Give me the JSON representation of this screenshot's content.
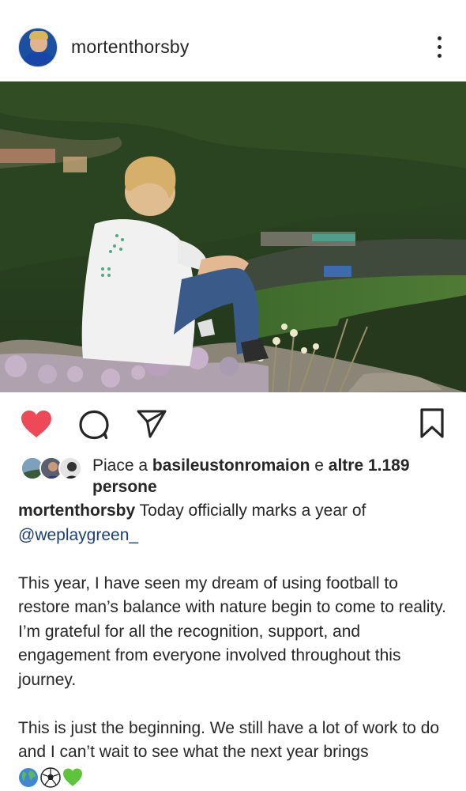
{
  "post": {
    "username": "mortenthorsby",
    "likes": {
      "prefix": "Piace a",
      "first_liker": "basileustonromaion",
      "conjunction": "e",
      "others": "altre 1.189",
      "suffix": "persone"
    },
    "caption": {
      "author": "mortenthorsby",
      "line1": "Today officially marks a year of",
      "mention": "@weplaygreen_",
      "paragraph2": "This year, I have seen my dream of using football to restore man’s balance with nature begin to come to reality. I’m grateful for all the recognition, support, and engagement from everyone involved throughout this journey.",
      "paragraph3": "This is just the beginning. We still have a lot of work to do and I can’t wait to see what the next year brings"
    },
    "emojis": [
      "globe-icon",
      "soccer-ball-icon",
      "green-heart-icon"
    ]
  },
  "colors": {
    "like_red": "#ed4956",
    "text": "#262626",
    "mention": "#1a3e73"
  }
}
